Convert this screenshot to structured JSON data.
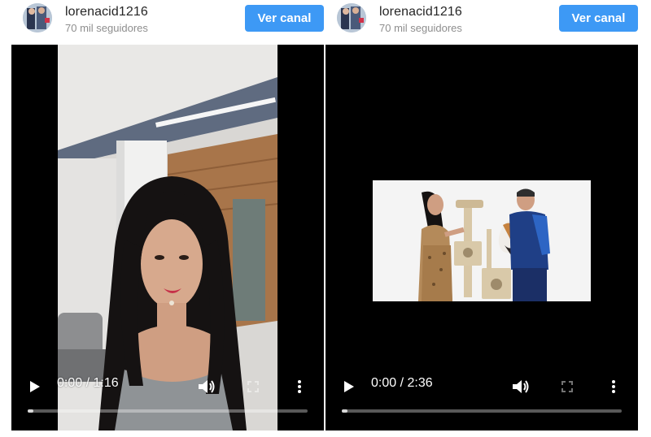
{
  "cards": [
    {
      "username": "lorenacid1216",
      "followers": "70 mil seguidores",
      "channel_button": "Ver canal",
      "player": {
        "time": "0:00 / 1:16",
        "progress": 0
      }
    },
    {
      "username": "lorenacid1216",
      "followers": "70 mil seguidores",
      "channel_button": "Ver canal",
      "player": {
        "time": "0:00 / 2:36",
        "progress": 0
      }
    }
  ],
  "colors": {
    "accent": "#3d99f5",
    "player_bg": "#000000"
  },
  "icons": [
    "play-icon",
    "volume-icon",
    "fullscreen-icon",
    "more-options-icon"
  ]
}
